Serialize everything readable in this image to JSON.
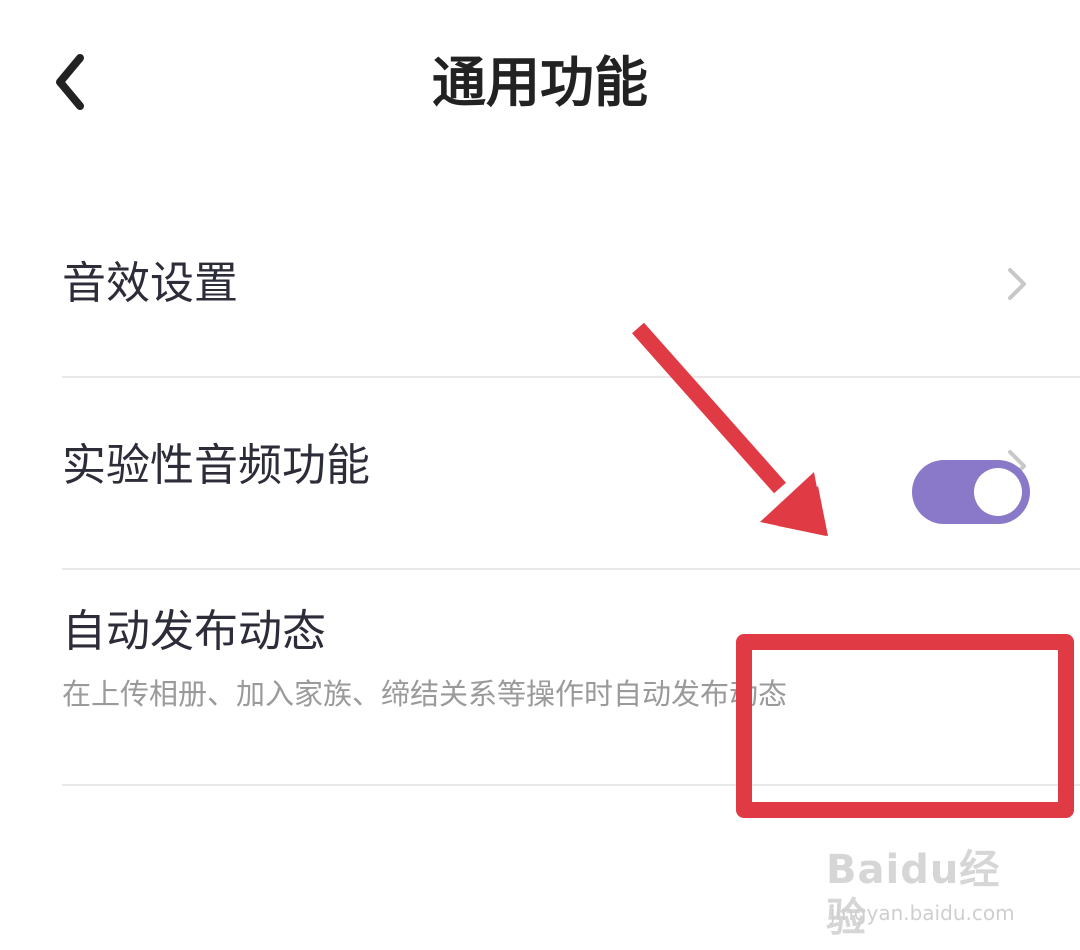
{
  "header": {
    "title": "通用功能",
    "back_icon": "chevron-left-icon"
  },
  "settings": {
    "items": [
      {
        "label": "音效设置",
        "type": "link",
        "icon": "chevron-right-icon"
      },
      {
        "label": "实验性音频功能",
        "type": "link",
        "icon": "chevron-right-icon"
      },
      {
        "label": "自动发布动态",
        "description": "在上传相册、加入家族、缔结关系等操作时自动发布动态",
        "type": "toggle",
        "checked": true
      }
    ]
  },
  "colors": {
    "toggle_on": "#8a78c8",
    "annotation": "#e03a45",
    "chevron": "#c8c8c8",
    "divider": "#e8e8e8"
  },
  "watermark": {
    "logo": "Baidu经验",
    "url": "jingyan.baidu.com"
  }
}
